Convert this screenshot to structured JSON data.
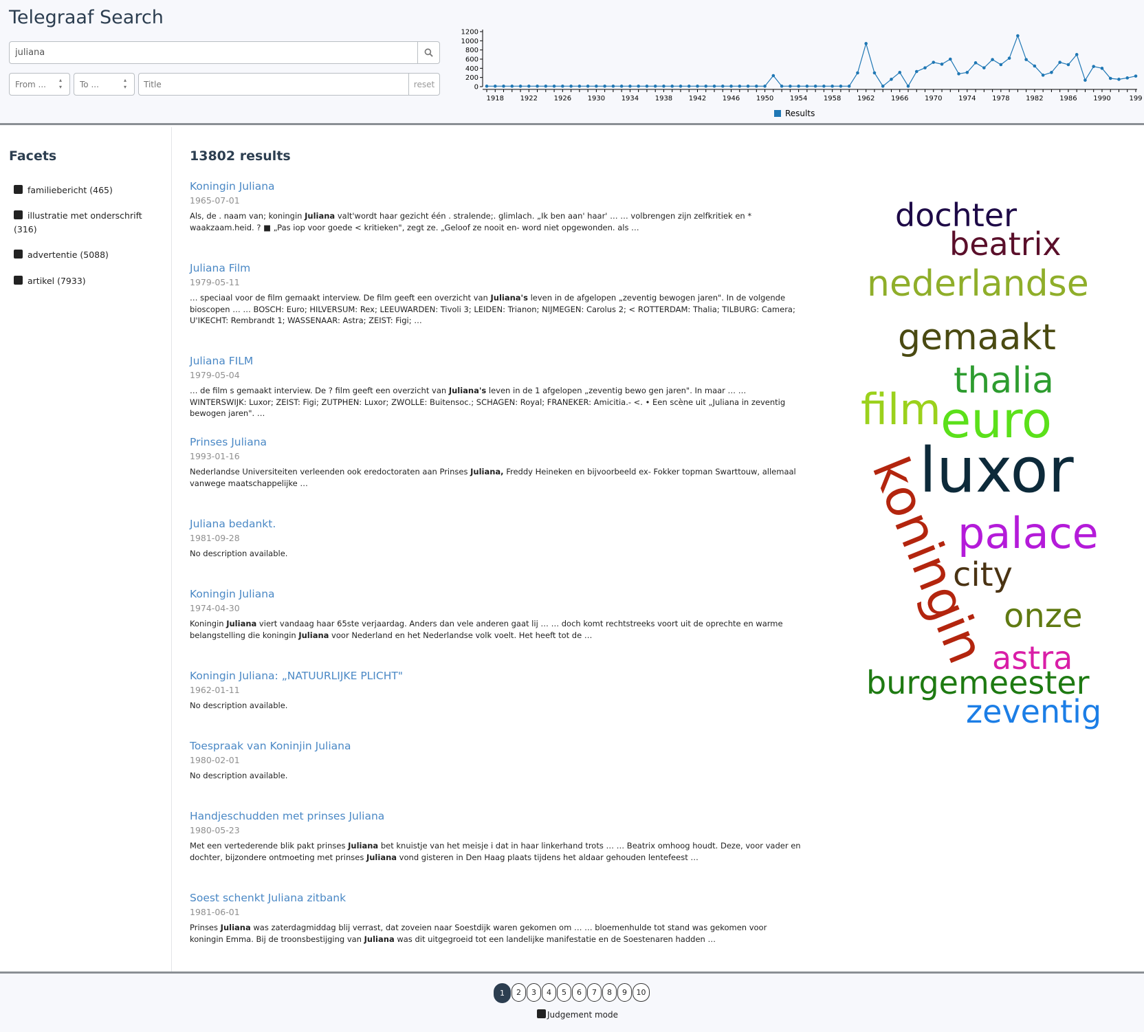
{
  "app": {
    "title": "Telegraaf Search"
  },
  "search": {
    "value": "juliana"
  },
  "filters": {
    "from_placeholder": "From ...",
    "to_placeholder": "To ...",
    "title_placeholder": "Title",
    "reset_label": "reset"
  },
  "chart_data": {
    "type": "line",
    "x": [
      1917,
      1918,
      1919,
      1920,
      1921,
      1922,
      1923,
      1924,
      1925,
      1926,
      1927,
      1928,
      1929,
      1930,
      1931,
      1932,
      1933,
      1934,
      1935,
      1936,
      1937,
      1938,
      1939,
      1940,
      1941,
      1942,
      1943,
      1944,
      1945,
      1946,
      1947,
      1948,
      1949,
      1950,
      1951,
      1952,
      1953,
      1954,
      1955,
      1956,
      1957,
      1958,
      1959,
      1960,
      1961,
      1962,
      1963,
      1964,
      1965,
      1966,
      1967,
      1968,
      1969,
      1970,
      1971,
      1972,
      1973,
      1974,
      1975,
      1976,
      1977,
      1978,
      1979,
      1980,
      1981,
      1982,
      1983,
      1984,
      1985,
      1986,
      1987,
      1988,
      1989,
      1990,
      1991,
      1992,
      1993,
      1994
    ],
    "series": [
      {
        "name": "Results",
        "values": [
          10,
          10,
          10,
          10,
          10,
          10,
          10,
          10,
          10,
          10,
          10,
          10,
          10,
          10,
          10,
          10,
          10,
          10,
          10,
          10,
          10,
          10,
          10,
          10,
          10,
          10,
          10,
          10,
          10,
          10,
          10,
          10,
          10,
          10,
          240,
          10,
          10,
          10,
          10,
          10,
          10,
          10,
          10,
          10,
          300,
          940,
          300,
          10,
          160,
          310,
          10,
          330,
          410,
          530,
          490,
          600,
          280,
          310,
          520,
          410,
          590,
          480,
          620,
          1110,
          590,
          450,
          250,
          310,
          530,
          480,
          700,
          140,
          440,
          400,
          180,
          160,
          190,
          230
        ]
      }
    ],
    "xticks": [
      "1918",
      "1922",
      "1926",
      "1930",
      "1934",
      "1938",
      "1942",
      "1946",
      "1950",
      "1954",
      "1958",
      "1962",
      "1966",
      "1970",
      "1974",
      "1978",
      "1982",
      "1986",
      "1990",
      "199"
    ],
    "yticks": [
      0,
      200,
      400,
      600,
      800,
      1000,
      1200
    ],
    "ylim": [
      0,
      1200
    ],
    "legend": {
      "label": "Results",
      "position": "bottom"
    },
    "color": "#1f77b4"
  },
  "facets": {
    "title": "Facets",
    "items": [
      {
        "label": "familiebericht (465)"
      },
      {
        "label": "illustratie met onderschrift (316)"
      },
      {
        "label": "advertentie (5088)"
      },
      {
        "label": "artikel (7933)"
      }
    ]
  },
  "results": {
    "count_label": "13802 results",
    "items": [
      {
        "title": "Koningin Juliana",
        "date": "1965-07-01",
        "snippet": [
          {
            "t": "Als, de . naam van; koningin "
          },
          {
            "b": "Juliana"
          },
          {
            "t": " valt'wordt haar gezicht één . stralende;. glimlach. „Ik ben aan' haar' … … volbrengen zijn zelfkritiek en * waakzaam.heid. ? ■ „Pas iop voor goede < kritieken\", zegt ze. „Geloof ze nooit en- word niet opgewonden. als …"
          }
        ]
      },
      {
        "title": "Juliana Film",
        "date": "1979-05-11",
        "snippet": [
          {
            "t": "… speciaal voor de film gemaakt interview. De film geeft een overzicht van "
          },
          {
            "b": "Juliana's"
          },
          {
            "t": " leven in de afgelopen „zeventig bewogen jaren\". In de volgende bioscopen … … BOSCH: Euro; HILVERSUM: Rex; LEEUWARDEN: Tivoli 3; LEIDEN: Trianon; NIJMEGEN: Carolus 2; < ROTTERDAM: Thalia; TILBURG: Camera; U'IKECHT: Rembrandt 1; WASSENAAR: Astra; ZEIST: Figi; …"
          }
        ]
      },
      {
        "title": "Juliana FILM",
        "date": "1979-05-04",
        "snippet": [
          {
            "t": "… de film s gemaakt interview. De ? film geeft een overzicht van "
          },
          {
            "b": "Juliana's"
          },
          {
            "t": " leven in de 1 afgelopen „zeventig bewo gen jaren\". In maar … … WINTERSWIJK: Luxor; ZEIST: Figi; ZUTPHEN: Luxor; ZWOLLE: Buitensoc.; SCHAGEN: Royal; FRANEKER: Amicitia.- <. • Een scène uit „Juliana in zeventig bewogen jaren\". …"
          }
        ]
      },
      {
        "title": "Prinses Juliana",
        "date": "1993-01-16",
        "snippet": [
          {
            "t": "Nederlandse Universiteiten verleenden ook eredoctoraten aan Prinses "
          },
          {
            "b": "Juliana,"
          },
          {
            "t": " Freddy Heineken en bijvoorbeeld ex- Fokker topman Swarttouw, allemaal vanwege maatschappelijke …"
          }
        ]
      },
      {
        "title": "Juliana bedankt.",
        "date": "1981-09-28",
        "snippet": [
          {
            "t": "No description available."
          }
        ]
      },
      {
        "title": "Koningin Juliana",
        "date": "1974-04-30",
        "snippet": [
          {
            "t": "Koningin "
          },
          {
            "b": "Juliana"
          },
          {
            "t": " viert vandaag haar 65ste verjaardag. Anders dan vele anderen gaat lij … … doch komt rechtstreeks voort uit de oprechte en warme belangstelling die koningin "
          },
          {
            "b": "Juliana"
          },
          {
            "t": " voor Nederland en het Nederlandse volk voelt. Het heeft tot de …"
          }
        ]
      },
      {
        "title": "Koningin Juliana: „NATUURLIJKE PLICHT\"",
        "date": "1962-01-11",
        "snippet": [
          {
            "t": "No description available."
          }
        ]
      },
      {
        "title": "Toespraak van Koninjin Juliana",
        "date": "1980-02-01",
        "snippet": [
          {
            "t": "No description available."
          }
        ]
      },
      {
        "title": "Handjeschudden met prinses Juliana",
        "date": "1980-05-23",
        "snippet": [
          {
            "t": "Met een vertederende blik pakt prinses "
          },
          {
            "b": "Juliana"
          },
          {
            "t": " bet knuistje van het meisje i dat in haar linkerhand trots … … Beatrix omhoog houdt. Deze, voor vader en dochter, bijzondere ontmoeting met prinses "
          },
          {
            "b": "Juliana"
          },
          {
            "t": " vond gisteren in Den Haag plaats tijdens het aldaar gehouden lentefeest …"
          }
        ]
      },
      {
        "title": "Soest schenkt Juliana zitbank",
        "date": "1981-06-01",
        "snippet": [
          {
            "t": "Prinses "
          },
          {
            "b": "Juliana"
          },
          {
            "t": " was zaterdagmiddag blij verrast, dat zoveien naar Soestdijk waren gekomen om … … bloemenhulde tot stand was gekomen voor koningin Emma. Bij de troonsbestijging van "
          },
          {
            "b": "Juliana"
          },
          {
            "t": " was dit uitgegroeid tot een landelijke manifestatie en de Soestenaren hadden …"
          }
        ]
      }
    ]
  },
  "wordcloud": {
    "words": [
      {
        "text": "dochter",
        "color": "#1e0a47"
      },
      {
        "text": "beatrix",
        "color": "#5a0f2a"
      },
      {
        "text": "nederlandse",
        "color": "#8fae2a"
      },
      {
        "text": "gemaakt",
        "color": "#4a4a12"
      },
      {
        "text": "thalia",
        "color": "#2d9c2f"
      },
      {
        "text": "film",
        "color": "#9bd11c"
      },
      {
        "text": "euro",
        "color": "#5be01a"
      },
      {
        "text": "luxor",
        "color": "#0d2a3a"
      },
      {
        "text": "koningin",
        "color": "#b3250e"
      },
      {
        "text": "palace",
        "color": "#b41bd9"
      },
      {
        "text": "city",
        "color": "#4a3313"
      },
      {
        "text": "onze",
        "color": "#607a12"
      },
      {
        "text": "astra",
        "color": "#d91ea7"
      },
      {
        "text": "burgemeester",
        "color": "#1e7a12"
      },
      {
        "text": "zeventig",
        "color": "#1c7ee6"
      }
    ]
  },
  "pagination": {
    "pages": [
      "1",
      "2",
      "3",
      "4",
      "5",
      "6",
      "7",
      "8",
      "9",
      "10"
    ],
    "active": "1"
  },
  "judgement": {
    "label": "Judgement mode"
  }
}
